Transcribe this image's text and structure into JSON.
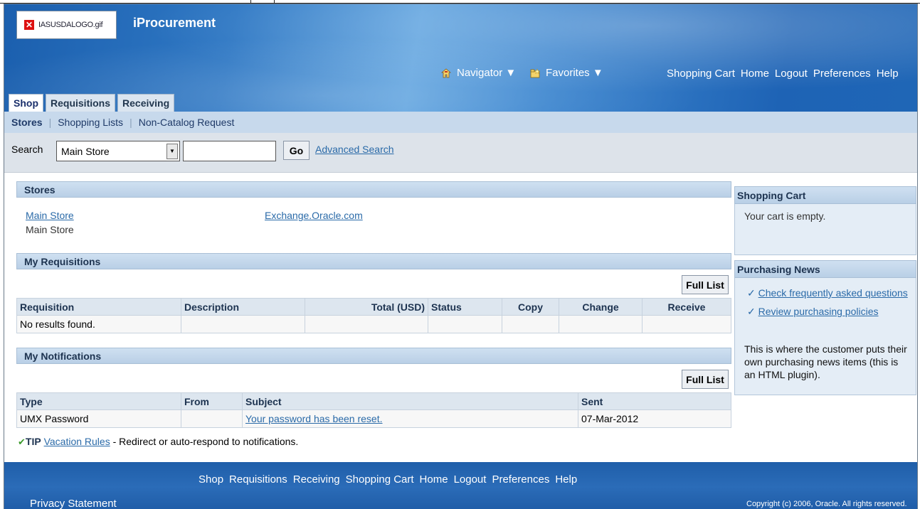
{
  "header": {
    "logo_text": "IASUSDALOGO.gif",
    "app_title": "iProcurement",
    "navigator_label": "Navigator ▼",
    "favorites_label": "Favorites ▼",
    "global_links": [
      "Shopping Cart",
      "Home",
      "Logout",
      "Preferences",
      "Help"
    ],
    "tabs": [
      "Shop",
      "Requisitions",
      "Receiving"
    ],
    "active_tab": "Shop"
  },
  "subnav": {
    "items": [
      "Stores",
      "Shopping Lists",
      "Non-Catalog Request"
    ],
    "active": "Stores"
  },
  "search": {
    "label": "Search",
    "selected_store": "Main Store",
    "input_value": "",
    "go_label": "Go",
    "advanced_label": "Advanced Search"
  },
  "stores": {
    "title": "Stores",
    "store1_link": "Main Store",
    "store1_desc": "Main Store",
    "store2_link": "Exchange.Oracle.com"
  },
  "requisitions": {
    "title": "My Requisitions",
    "full_list_label": "Full List",
    "columns": [
      "Requisition",
      "Description",
      "Total (USD)",
      "Status",
      "Copy",
      "Change",
      "Receive"
    ],
    "empty_text": "No results found."
  },
  "notifications": {
    "title": "My Notifications",
    "full_list_label": "Full List",
    "columns": [
      "Type",
      "From",
      "Subject",
      "Sent"
    ],
    "rows": [
      {
        "type": "UMX Password",
        "from": "",
        "subject": "Your password has been reset.",
        "sent": "07-Mar-2012"
      }
    ],
    "tip_label": "TIP",
    "tip_link": "Vacation Rules",
    "tip_text": " - Redirect or auto-respond to notifications."
  },
  "cart": {
    "title": "Shopping Cart",
    "text": "Your cart is empty."
  },
  "news": {
    "title": "Purchasing News",
    "links": [
      "Check frequently asked questions",
      "Review purchasing policies"
    ],
    "text": "This is where the customer puts their own purchasing news items (this is an HTML plugin)."
  },
  "footer": {
    "links": [
      "Shop",
      "Requisitions",
      "Receiving",
      "Shopping Cart",
      "Home",
      "Logout",
      "Preferences",
      "Help"
    ],
    "privacy": "Privacy Statement",
    "copyright": "Copyright (c) 2006, Oracle. All rights reserved."
  },
  "colors": {
    "header_blue": "#1f66b6",
    "link_blue": "#2a6aa8",
    "section_header": "#c7d9ec"
  }
}
